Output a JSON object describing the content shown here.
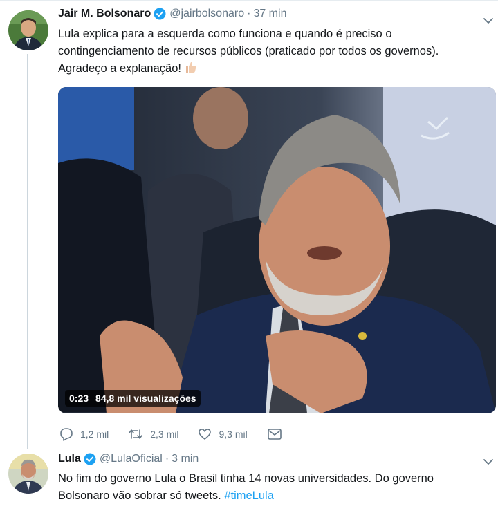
{
  "tweet1": {
    "name": "Jair M. Bolsonaro",
    "handle": "@jairbolsonaro",
    "separator": "·",
    "time": "37 min",
    "text_lines": [
      "Lula explica para a esquerda como funciona e quando é preciso o",
      "contingenciamento de recursos públicos (praticado por todos os governos).",
      "Agradeço a explanação!"
    ],
    "video": {
      "duration": "0:23",
      "views": "84,8 mil visualizações"
    },
    "actions": {
      "replies": "1,2 mil",
      "retweets": "2,3 mil",
      "likes": "9,3 mil"
    }
  },
  "tweet2": {
    "name": "Lula",
    "handle": "@LulaOficial",
    "separator": "·",
    "time": "3 min",
    "text_lines": [
      "No fim do governo Lula o Brasil tinha 14 novas universidades. Do governo",
      "Bolsonaro vão sobrar só tweets."
    ],
    "hashtag": "#timeLula"
  },
  "colors": {
    "accent": "#1da1f2",
    "muted": "#657786",
    "text": "#14171a",
    "thread_line": "#ccd6dd"
  },
  "icons": [
    "verified-badge-icon",
    "chevron-down-icon",
    "thumbs-up-emoji-icon",
    "reply-icon",
    "retweet-icon",
    "like-icon",
    "direct-message-icon"
  ]
}
